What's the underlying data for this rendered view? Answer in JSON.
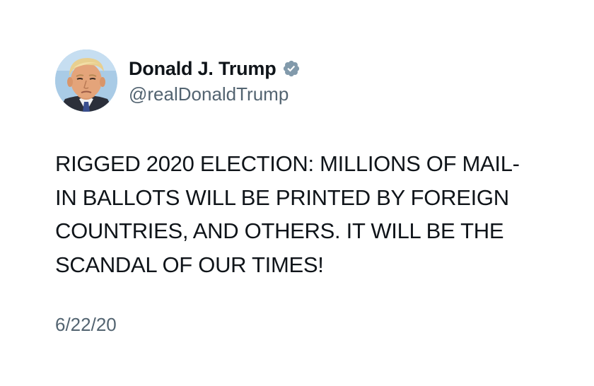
{
  "tweet": {
    "author": {
      "display_name": "Donald J. Trump",
      "handle": "@realDonaldTrump",
      "verified_icon": "verified-badge-icon",
      "badge_color": "#829aab"
    },
    "text": "RIGGED 2020 ELECTION: MILLIONS OF MAIL-\nIN BALLOTS WILL BE PRINTED BY FOREIGN\nCOUNTRIES, AND OTHERS. IT WILL BE THE\nSCANDAL OF OUR TIMES!",
    "timestamp": "6/22/20"
  },
  "colors": {
    "text_primary": "#0f1419",
    "text_secondary": "#536471",
    "background": "#ffffff"
  }
}
